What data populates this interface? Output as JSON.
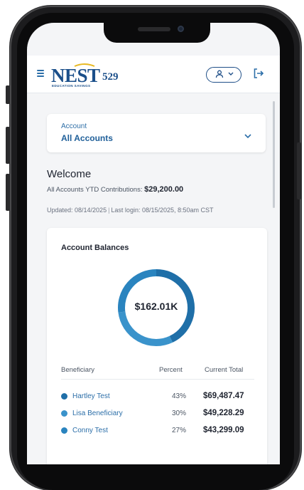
{
  "header": {
    "logo_text": "NEST",
    "logo_number": "529",
    "logo_subtext": "EDUCATION SAVINGS",
    "menu_icon": "hamburger-menu-icon",
    "user_icon": "user-icon",
    "logout_icon": "logout-icon"
  },
  "account": {
    "label": "Account",
    "value": "All Accounts"
  },
  "welcome": {
    "title": "Welcome",
    "ytd_label": "All Accounts YTD Contributions:",
    "ytd_value": "$29,200.00",
    "updated": "Updated: 08/14/2025",
    "separator": "|",
    "last_login": "Last login: 08/15/2025, 8:50am CST"
  },
  "balances": {
    "title": "Account Balances",
    "total": "$162.01K",
    "columns": {
      "beneficiary": "Beneficiary",
      "percent": "Percent",
      "current_total": "Current Total"
    },
    "rows": [
      {
        "name": "Hartley Test",
        "percent": "43%",
        "total": "$69,487.47",
        "share": 43,
        "color": "#1f6fa8"
      },
      {
        "name": "Lisa Beneficiary",
        "percent": "30%",
        "total": "$49,228.29",
        "share": 30,
        "color": "#3a93cb"
      },
      {
        "name": "Conny Test",
        "percent": "27%",
        "total": "$43,299.09",
        "share": 27,
        "color": "#2a84bf"
      }
    ]
  },
  "colors": {
    "brand": "#1b4f8a",
    "accent": "#2b6ea8",
    "gold": "#e8b923"
  }
}
